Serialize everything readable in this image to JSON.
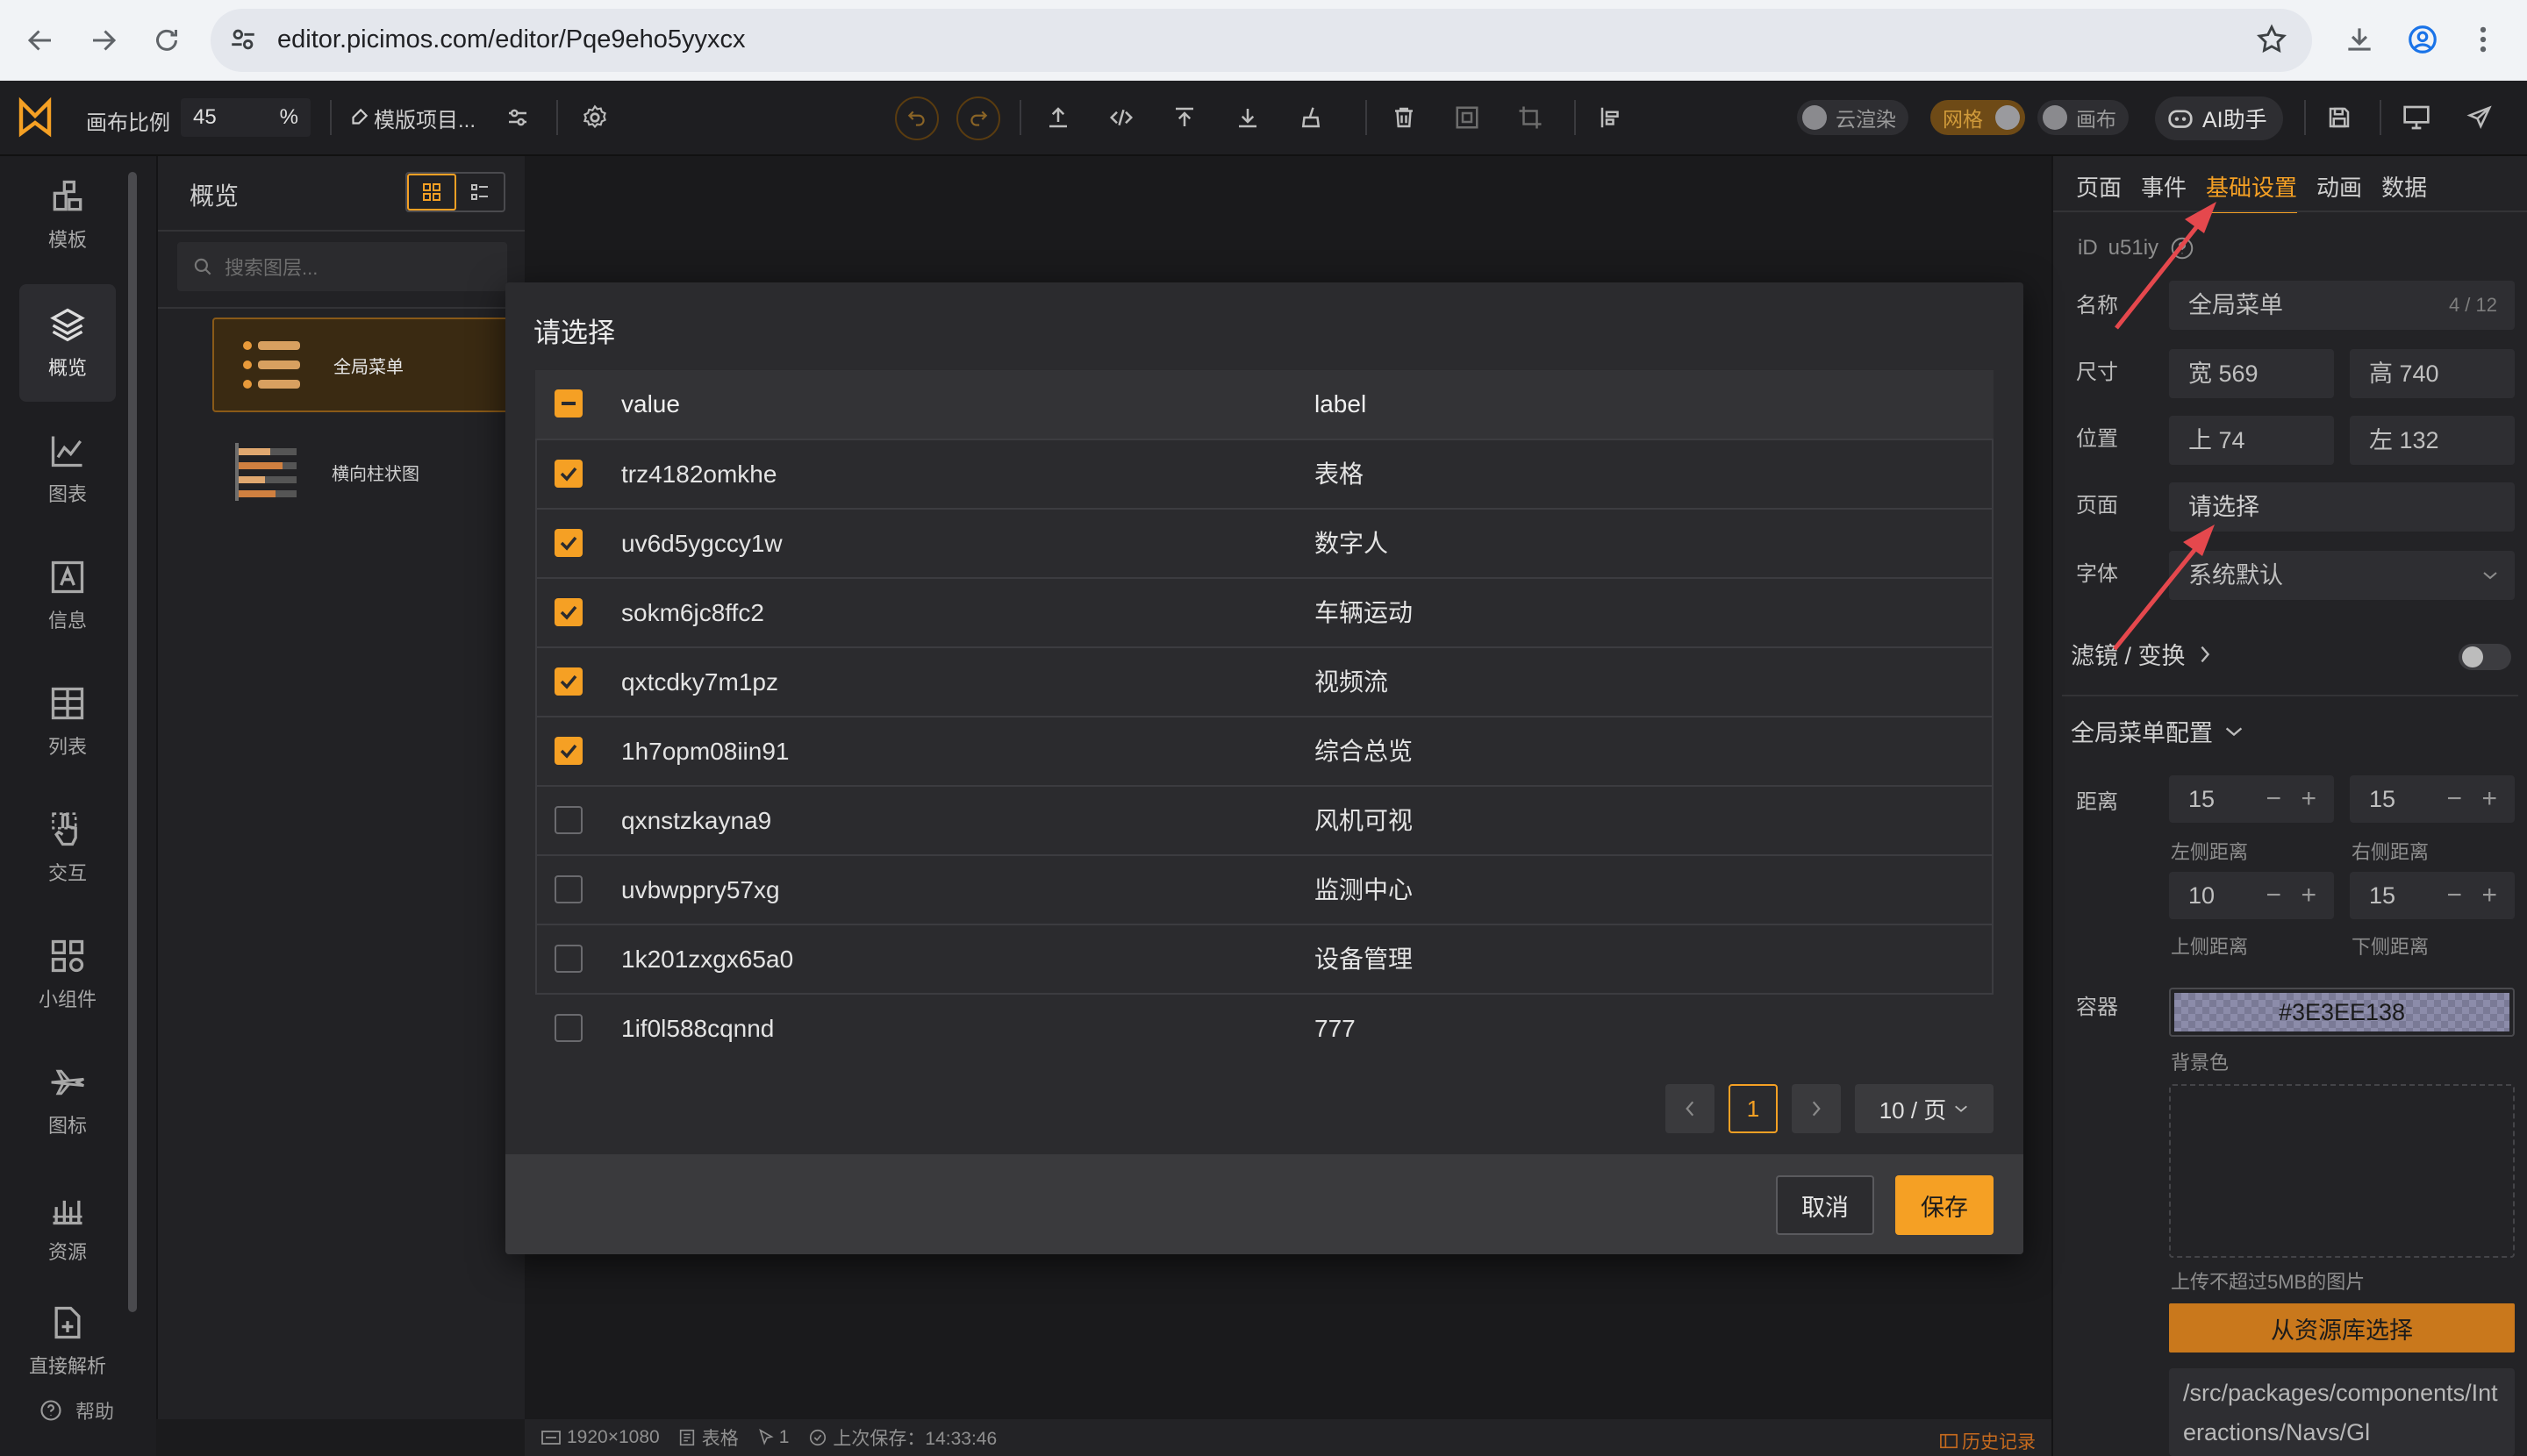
{
  "browser": {
    "url": "editor.picimos.com/editor/Pqe9eho5yyxcx"
  },
  "toolbar": {
    "ratio_label": "画布比例",
    "ratio_value": "45",
    "ratio_unit": "%",
    "template_label": "模版项目...",
    "cloud_render": "云渲染",
    "grid": "网格",
    "canvas": "画布",
    "ai": "AI助手"
  },
  "sidebar": {
    "items": [
      {
        "label": "模板",
        "icon": "template-icon"
      },
      {
        "label": "概览",
        "icon": "layers-icon"
      },
      {
        "label": "图表",
        "icon": "chart-icon"
      },
      {
        "label": "信息",
        "icon": "info-icon"
      },
      {
        "label": "列表",
        "icon": "table-icon"
      },
      {
        "label": "交互",
        "icon": "pointer-icon"
      },
      {
        "label": "小组件",
        "icon": "widget-icon"
      },
      {
        "label": "图标",
        "icon": "plane-icon"
      },
      {
        "label": "资源",
        "icon": "resource-icon"
      },
      {
        "label": "直接解析",
        "icon": "file-add-icon"
      }
    ],
    "help": "帮助"
  },
  "layers": {
    "title": "概览",
    "search_placeholder": "搜索图层...",
    "items": [
      {
        "name": "全局菜单"
      },
      {
        "name": "横向柱状图"
      }
    ]
  },
  "status": {
    "size": "1920×1080",
    "component": "表格",
    "selected": "1",
    "saved": "上次保存：14:33:46",
    "history": "历史记录"
  },
  "rpanel": {
    "tabs": [
      "页面",
      "事件",
      "基础设置",
      "动画",
      "数据"
    ],
    "active_tab": "基础设置",
    "id_label": "iD",
    "id_value": "u51iy",
    "name_label": "名称",
    "name_value": "全局菜单",
    "name_count": "4 / 12",
    "size_label": "尺寸",
    "width": "宽 569",
    "height": "高 740",
    "pos_label": "位置",
    "top": "上 74",
    "left": "左 132",
    "page_label": "页面",
    "page_value": "请选择",
    "font_label": "字体",
    "font_value": "系统默认",
    "filter_label": "滤镜 / 变换",
    "config_label": "全局菜单配置",
    "distance_label": "距离",
    "dist": [
      {
        "value": "15",
        "label": "左侧距离"
      },
      {
        "value": "15",
        "label": "右侧距离"
      },
      {
        "value": "10",
        "label": "上侧距离"
      },
      {
        "value": "15",
        "label": "下侧距离"
      }
    ],
    "container_label": "容器",
    "color_value": "#3E3EE138",
    "bg_label": "背景色",
    "upload_hint": "上传不超过5MB的图片",
    "resource_button": "从资源库选择",
    "path_value": "/src/packages/components/Interactions/Navs/Gl"
  },
  "modal": {
    "title": "请选择",
    "col_value": "value",
    "col_label": "label",
    "rows": [
      {
        "value": "trz4182omkhe",
        "label": "表格",
        "checked": true
      },
      {
        "value": "uv6d5ygccy1w",
        "label": "数字人",
        "checked": true
      },
      {
        "value": "sokm6jc8ffc2",
        "label": "车辆运动",
        "checked": true
      },
      {
        "value": "qxtcdky7m1pz",
        "label": "视频流",
        "checked": true
      },
      {
        "value": "1h7opm08iin91",
        "label": "综合总览",
        "checked": true
      },
      {
        "value": "qxnstzkayna9",
        "label": "风机可视",
        "checked": false
      },
      {
        "value": "uvbwppry57xg",
        "label": "监测中心",
        "checked": false
      },
      {
        "value": "1k201zxgx65a0",
        "label": "设备管理",
        "checked": false
      },
      {
        "value": "1if0l588cqnnd",
        "label": "777",
        "checked": false
      }
    ],
    "page": "1",
    "page_size": "10 / 页",
    "cancel": "取消",
    "save": "保存"
  },
  "colors": {
    "accent": "#f5a024",
    "arrow": "#e5484d"
  }
}
